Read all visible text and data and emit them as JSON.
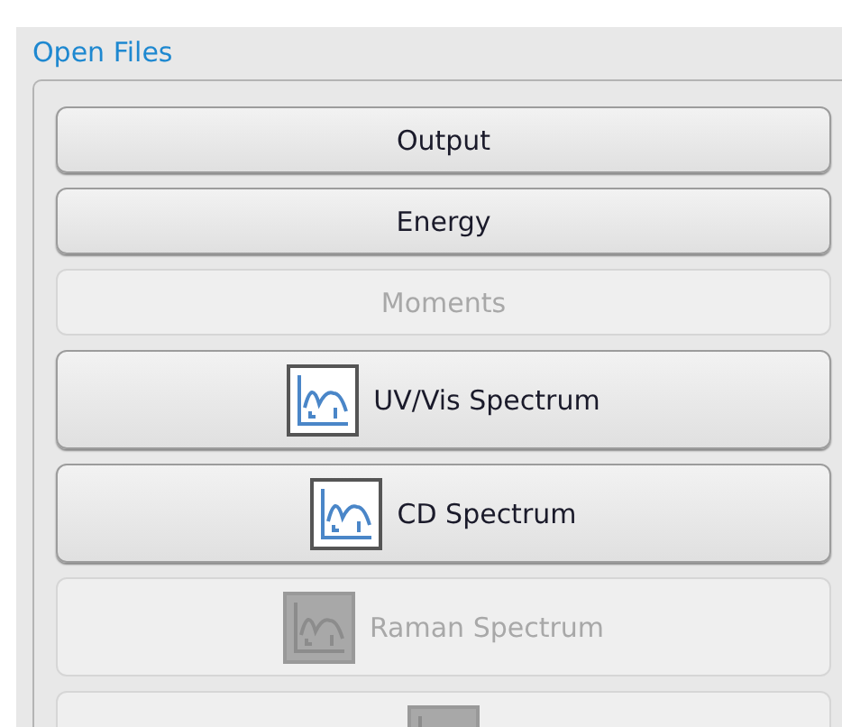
{
  "group": {
    "title": "Open Files"
  },
  "buttons": [
    {
      "kind": "plain",
      "label": "Output",
      "disabled": false
    },
    {
      "kind": "plain",
      "label": "Energy",
      "disabled": false
    },
    {
      "kind": "plain",
      "label": "Moments",
      "disabled": true
    },
    {
      "kind": "spectrum",
      "label": "UV/Vis Spectrum",
      "disabled": false
    },
    {
      "kind": "spectrum",
      "label": "CD Spectrum",
      "disabled": false
    },
    {
      "kind": "spectrum",
      "label": "Raman Spectrum",
      "disabled": true
    },
    {
      "kind": "spectrum",
      "disabled": true
    }
  ]
}
